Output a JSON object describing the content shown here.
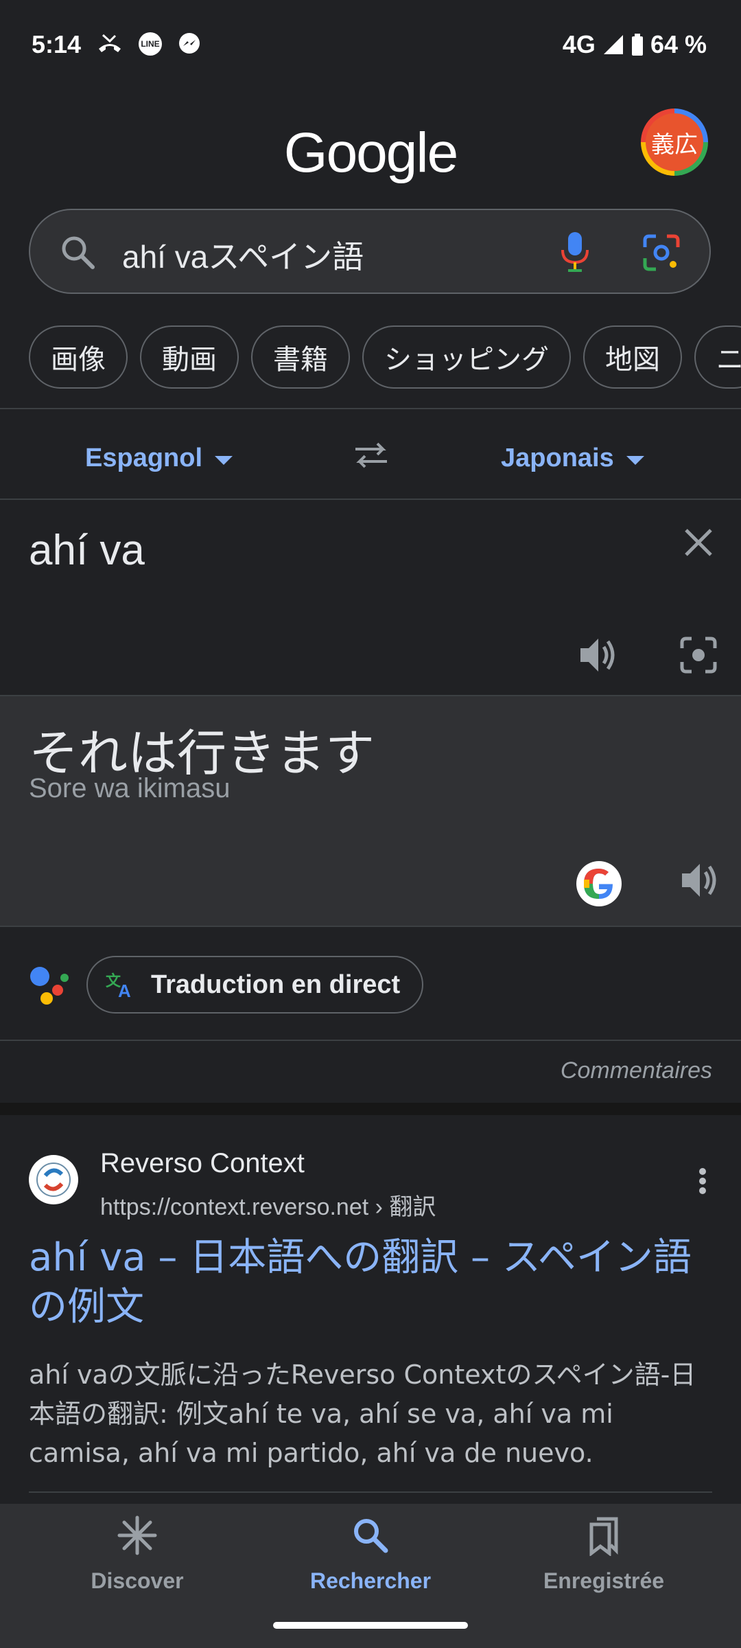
{
  "status_bar": {
    "time": "5:14",
    "network": "4G",
    "battery": "64 %",
    "left_icons": [
      "missed-call-icon",
      "line-app-icon",
      "messenger-icon"
    ],
    "line_icon_text": "LINE"
  },
  "header": {
    "logo_text": "Google",
    "avatar_text": "義広"
  },
  "search": {
    "query": "ahí vaスペイン語"
  },
  "chips": [
    "画像",
    "動画",
    "書籍",
    "ショッピング",
    "地図",
    "ニ"
  ],
  "translate": {
    "source_lang": "Espagnol",
    "target_lang": "Japonais",
    "source_text": "ahí va",
    "translated_text": "それは行きます",
    "transliteration": "Sore wa ikimasu",
    "live_button": "Traduction en direct",
    "feedback": "Commentaires"
  },
  "result": {
    "site_name": "Reverso Context",
    "url": "https://context.reverso.net › 翻訳",
    "title": "ahí va – 日本語への翻訳 – スペイン語の例文",
    "snippet": "ahí vaの文脈に沿ったReverso Contextのスペイン語-日本語の翻訳: 例文ahí te va, ahí se va, ahí va mi camisa, ahí va mi partido, ahí va de nuevo."
  },
  "bottom_nav": {
    "items": [
      {
        "label": "Discover",
        "icon": "asterisk-icon",
        "active": false
      },
      {
        "label": "Rechercher",
        "icon": "search-icon",
        "active": true
      },
      {
        "label": "Enregistrée",
        "icon": "bookmarks-icon",
        "active": false
      }
    ]
  },
  "colors": {
    "background": "#202124",
    "accent": "#8ab4f8",
    "avatar": "#e8542d"
  }
}
